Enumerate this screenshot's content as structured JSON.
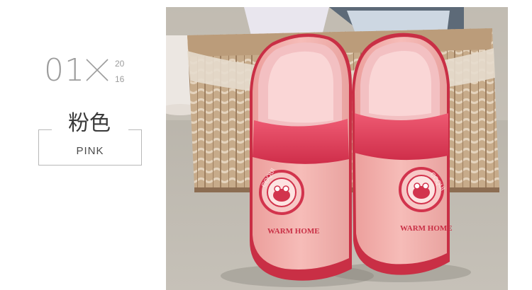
{
  "product": {
    "index": "01",
    "year_top": "20",
    "year_bottom": "16",
    "color_name_cn": "粉色",
    "color_name_en": "PINK"
  },
  "photo": {
    "logo_top_text": "COQUI",
    "logo_right_text": "COQUI",
    "slipper_text": "WARM HOME",
    "colors": {
      "upper": "#f3b2ae",
      "cuff": "#e0415a",
      "sole": "#c92f45",
      "lining": "#f4c5c6",
      "carpet": "#bdb8ae",
      "basket": "#c9ad8c"
    }
  }
}
